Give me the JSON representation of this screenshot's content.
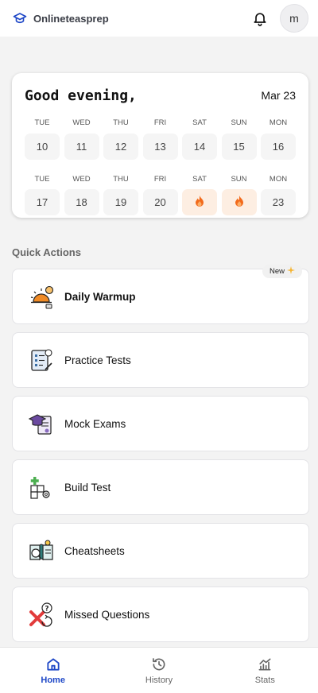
{
  "app": {
    "brand_name": "Onlineteasprep",
    "avatar_initial": "m"
  },
  "greeting_card": {
    "greeting": "Good evening,",
    "date": "Mar 23",
    "weeks": [
      [
        {
          "day": "TUE",
          "num": "10",
          "streak": false
        },
        {
          "day": "WED",
          "num": "11",
          "streak": false
        },
        {
          "day": "THU",
          "num": "12",
          "streak": false
        },
        {
          "day": "FRI",
          "num": "13",
          "streak": false
        },
        {
          "day": "SAT",
          "num": "14",
          "streak": false
        },
        {
          "day": "SUN",
          "num": "15",
          "streak": false
        },
        {
          "day": "MON",
          "num": "16",
          "streak": false
        }
      ],
      [
        {
          "day": "TUE",
          "num": "17",
          "streak": false
        },
        {
          "day": "WED",
          "num": "18",
          "streak": false
        },
        {
          "day": "THU",
          "num": "19",
          "streak": false
        },
        {
          "day": "FRI",
          "num": "20",
          "streak": false
        },
        {
          "day": "SAT",
          "num": "",
          "streak": true
        },
        {
          "day": "SUN",
          "num": "",
          "streak": true
        },
        {
          "day": "MON",
          "num": "23",
          "streak": false
        }
      ]
    ]
  },
  "quick_actions": {
    "title": "Quick Actions",
    "new_badge": "New",
    "items": [
      {
        "label": "Daily Warmup",
        "icon": "sunrise-icon"
      },
      {
        "label": "Practice Tests",
        "icon": "clipboard-icon"
      },
      {
        "label": "Mock Exams",
        "icon": "graduation-cap-icon"
      },
      {
        "label": "Build Test",
        "icon": "blocks-icon"
      },
      {
        "label": "Cheatsheets",
        "icon": "book-icon"
      },
      {
        "label": "Missed Questions",
        "icon": "missed-question-icon"
      }
    ]
  },
  "bottom_nav": {
    "home": "Home",
    "history": "History",
    "stats": "Stats"
  },
  "colors": {
    "accent": "#1f48c7",
    "streak_bg": "#fdeee2",
    "flame": "#f26a1b"
  }
}
